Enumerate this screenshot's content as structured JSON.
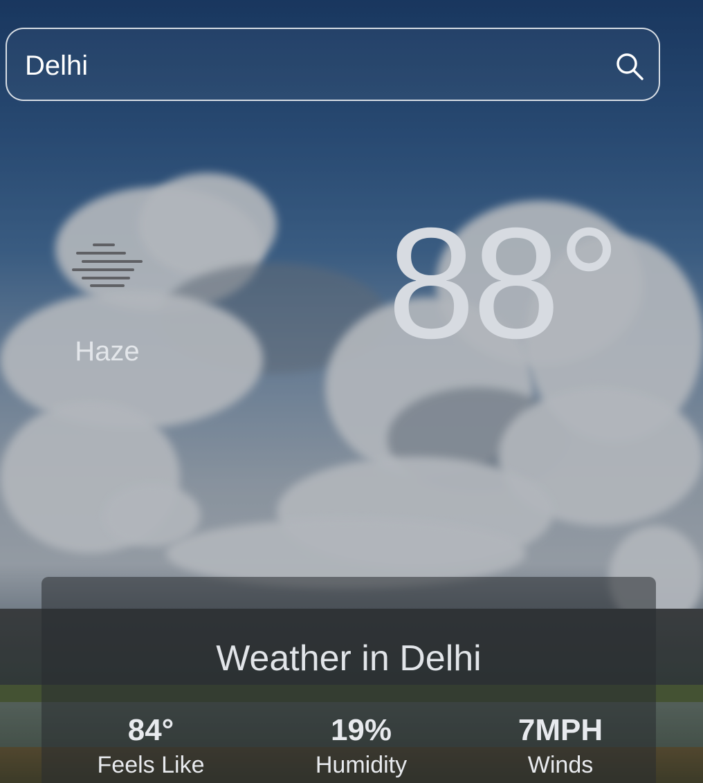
{
  "search": {
    "value": "Delhi",
    "icon": "search-icon"
  },
  "current": {
    "condition": "Haze",
    "condition_icon": "haze-icon",
    "temperature": "88°"
  },
  "details": {
    "title": "Weather in Delhi",
    "stats": [
      {
        "value": "84°",
        "label": "Feels Like"
      },
      {
        "value": "19%",
        "label": "Humidity"
      },
      {
        "value": "7MPH",
        "label": "Winds"
      }
    ]
  }
}
